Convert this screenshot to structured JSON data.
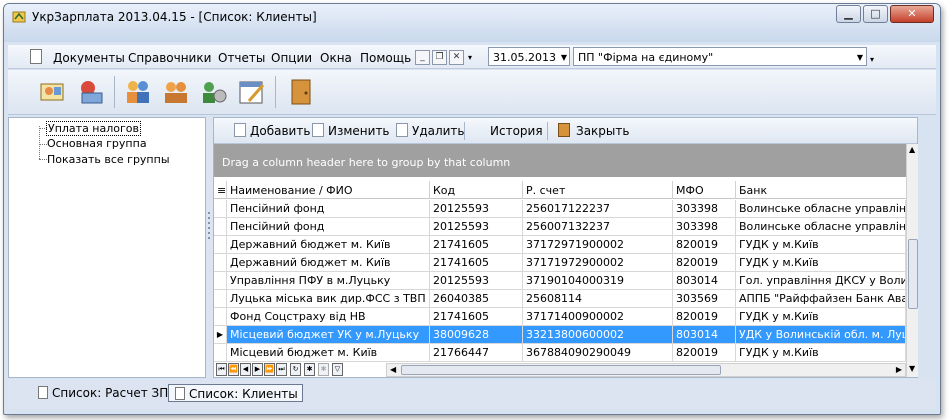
{
  "window": {
    "title": "УкрЗарплата 2013.04.15 - [Список: Клиенты]",
    "controls": {
      "minimize": "▁",
      "maximize": "□",
      "close": "✕"
    }
  },
  "menu": {
    "items": [
      "Документы",
      "Справочники",
      "Отчеты",
      "Опции",
      "Окна",
      "Помощь"
    ],
    "date": "31.05.2013",
    "organization": "ПП \"Фірма на єдиному\""
  },
  "tree": {
    "items": [
      "Уплата налогов",
      "Основная группа",
      "Показать все группы"
    ]
  },
  "grid_toolbar": {
    "add": "Добавить",
    "edit": "Изменить",
    "delete": "Удалить",
    "history": "История",
    "close": "Закрыть"
  },
  "group_hint": "Drag a column header here to group by that column",
  "columns": [
    "Наименование / ФИО",
    "Код",
    "Р. счет",
    "МФО",
    "Банк"
  ],
  "rows": [
    [
      "Пенсійний фонд",
      "20125593",
      "256017122237",
      "303398",
      "Волинське обласне управління ВА"
    ],
    [
      "Пенсійний фонд",
      "20125593",
      "256007132237",
      "303398",
      "Волинське обласне управління ВА"
    ],
    [
      "Державний бюджет м. Київ",
      "21741605",
      "37172971900002",
      "820019",
      "ГУДК у м.Київ"
    ],
    [
      "Державний бюджет м. Київ",
      "21741605",
      "37171972900002",
      "820019",
      "ГУДК у м.Київ"
    ],
    [
      "Управління ПФУ в м.Луцьку",
      "20125593",
      "37190104000319",
      "803014",
      "Гол. управління ДКСУ у Волинськ"
    ],
    [
      "Луцька міська вик дир.ФСС з ТВП",
      "26040385",
      "25608114",
      "303569",
      "АППБ \"Райффайзен Банк Аваль\", С"
    ],
    [
      "Фонд Соцстраху від НВ",
      "21741605",
      "37171400900002",
      "820019",
      "ГУДК у м.Київ"
    ],
    [
      "Місцевий бюджет УК у м.Луцьку",
      "38009628",
      "33213800600002",
      "803014",
      "УДК у Волинській обл. м. Луцьк"
    ],
    [
      "Місцевий бюджет м. Київ",
      "21766447",
      "367884090290049",
      "820019",
      "ГУДК у м.Київ"
    ]
  ],
  "selected_row": 7,
  "tabs": [
    "Список: Расчет ЗП",
    "Список: Клиенты"
  ],
  "colors": {
    "selection": "#3399ff",
    "group_panel": "#a0a0a0"
  }
}
